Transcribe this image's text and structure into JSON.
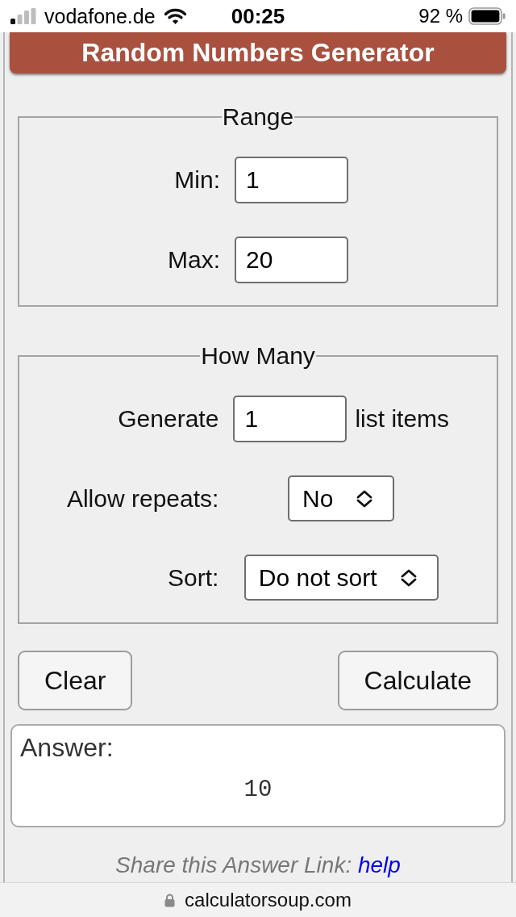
{
  "status_bar": {
    "carrier": "vodafone.de",
    "time": "00:25",
    "battery": "92 %"
  },
  "header": {
    "title": "Random Numbers Generator"
  },
  "fieldsets": [
    {
      "legend": "Range",
      "rows": [
        {
          "kind": "input",
          "label": "Min:",
          "value": "1"
        },
        {
          "kind": "input",
          "label": "Max:",
          "value": "20"
        }
      ]
    },
    {
      "legend": "How Many",
      "rows": [
        {
          "kind": "input",
          "label": "Generate",
          "value": "1",
          "suffix": "list items"
        },
        {
          "kind": "select",
          "label": "Allow repeats:",
          "value": "No"
        },
        {
          "kind": "select",
          "label": "Sort:",
          "value": "Do not sort"
        }
      ]
    }
  ],
  "clear_button": {
    "label": "Clear"
  },
  "calculate_button": {
    "label": "Calculate"
  },
  "answer": {
    "label": "Answer:",
    "value": "10"
  },
  "share": {
    "text": "Share this Answer Link:",
    "link": "help"
  },
  "address_bar": {
    "domain": "calculatorsoup.com",
    "secure": true
  }
}
